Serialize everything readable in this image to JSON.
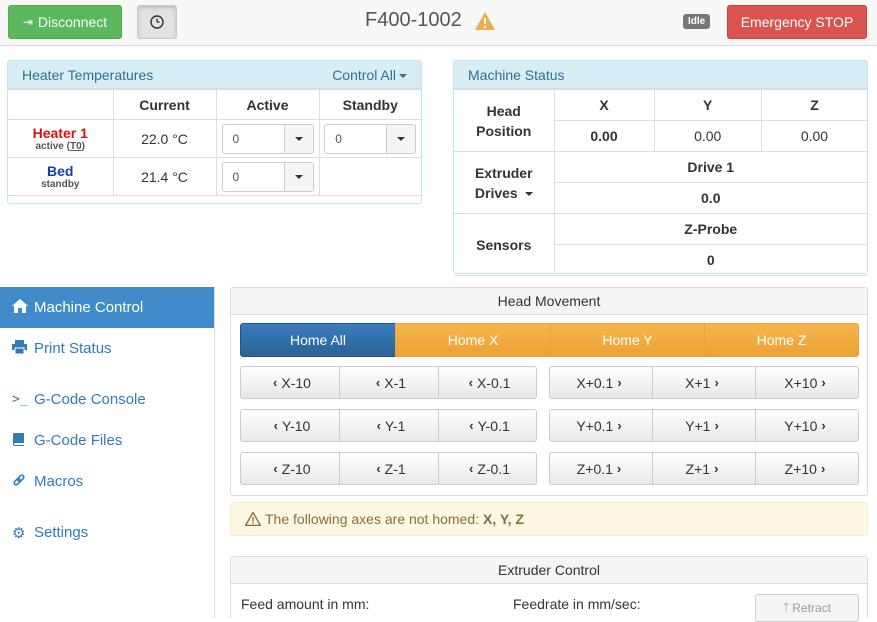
{
  "topbar": {
    "disconnect_label": "Disconnect",
    "machine_name": "F400-1002",
    "status": "Idle",
    "estop_label": "Emergency STOP"
  },
  "heater_panel": {
    "title": "Heater Temperatures",
    "control_all": "Control All",
    "columns": [
      "",
      "Current",
      "Active",
      "Standby"
    ],
    "heaters": [
      {
        "name": "Heater 1",
        "sub_prefix": "active (",
        "sub_tool": "T0",
        "sub_suffix": ")",
        "current": "22.0 °C",
        "active": "0",
        "standby": "0",
        "color": "#d9120f"
      },
      {
        "name": "Bed",
        "sub": "standby",
        "current": "21.4 °C",
        "active": "0",
        "color": "#1a3cb0"
      }
    ]
  },
  "machine_panel": {
    "title": "Machine Status",
    "head_position_label": "Head Position",
    "axes": [
      "X",
      "Y",
      "Z"
    ],
    "positions": [
      "0.00",
      "0.00",
      "0.00"
    ],
    "extruder_label": "Extruder Drives",
    "drive_label": "Drive 1",
    "drive_value": "0.0",
    "sensors_label": "Sensors",
    "probe_label": "Z-Probe",
    "probe_value": "0"
  },
  "sidebar": {
    "items": [
      {
        "label": "Machine Control",
        "icon": "home-icon"
      },
      {
        "label": "Print Status",
        "icon": "print-icon"
      },
      {
        "label": "G-Code Console",
        "icon": "console-icon"
      },
      {
        "label": "G-Code Files",
        "icon": "files-icon"
      },
      {
        "label": "Macros",
        "icon": "link-icon"
      },
      {
        "label": "Settings",
        "icon": "gear-icon"
      }
    ]
  },
  "head_movement": {
    "title": "Head Movement",
    "home": [
      "Home All",
      "Home X",
      "Home Y",
      "Home Z"
    ],
    "rows": [
      {
        "neg": [
          "X-10",
          "X-1",
          "X-0.1"
        ],
        "pos": [
          "X+0.1",
          "X+1",
          "X+10"
        ]
      },
      {
        "neg": [
          "Y-10",
          "Y-1",
          "Y-0.1"
        ],
        "pos": [
          "Y+0.1",
          "Y+1",
          "Y+10"
        ]
      },
      {
        "neg": [
          "Z-10",
          "Z-1",
          "Z-0.1"
        ],
        "pos": [
          "Z+0.1",
          "Z+1",
          "Z+10"
        ]
      }
    ]
  },
  "alert": {
    "text": "The following axes are not homed:",
    "axes": "X, Y, Z"
  },
  "extruder_control": {
    "title": "Extruder Control",
    "feed_label": "Feed amount in mm:",
    "feedrate_label": "Feedrate in mm/sec:",
    "retract_label": "Retract"
  },
  "colors": {
    "success": "#5cb85c",
    "danger": "#d9534f",
    "primary": "#428bca",
    "warning": "#f0ad4e"
  }
}
